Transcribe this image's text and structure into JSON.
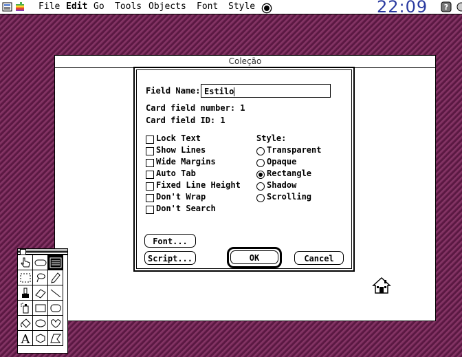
{
  "menubar": {
    "items": [
      "File",
      "Edit",
      "Go",
      "Tools",
      "Objects",
      "Font",
      "Style"
    ],
    "clock": "22:09"
  },
  "window": {
    "title": "Coleção"
  },
  "dialog": {
    "field_name_label": "Field Name:",
    "field_name_value": "Estilo",
    "card_field_number": "Card field number: 1",
    "card_field_id": "Card field ID: 1",
    "checkboxes": [
      "Lock Text",
      "Show Lines",
      "Wide Margins",
      "Auto Tab",
      "Fixed Line Height",
      "Don't Wrap",
      "Don't Search"
    ],
    "style_label": "Style:",
    "styles": [
      "Transparent",
      "Opaque",
      "Rectangle",
      "Shadow",
      "Scrolling"
    ],
    "selected_style": "Rectangle",
    "font_button": "Font...",
    "script_button": "Script...",
    "ok_button": "OK",
    "cancel_button": "Cancel"
  },
  "palette": {
    "tools": [
      "browse-tool",
      "button-tool",
      "field-tool",
      "select-tool",
      "lasso-tool",
      "pencil-tool",
      "bucket-tool",
      "eraser-tool",
      "line-tool",
      "spray-tool",
      "rectangle-tool",
      "round-rect-tool",
      "bucket-fill-tool",
      "oval-tool",
      "curve-tool",
      "text-tool",
      "regular-polygon-tool",
      "polygon-tool"
    ],
    "text_tool_glyph": "A"
  },
  "icons": [
    "apple-icon",
    "app-icon",
    "help-icon",
    "home-icon"
  ]
}
